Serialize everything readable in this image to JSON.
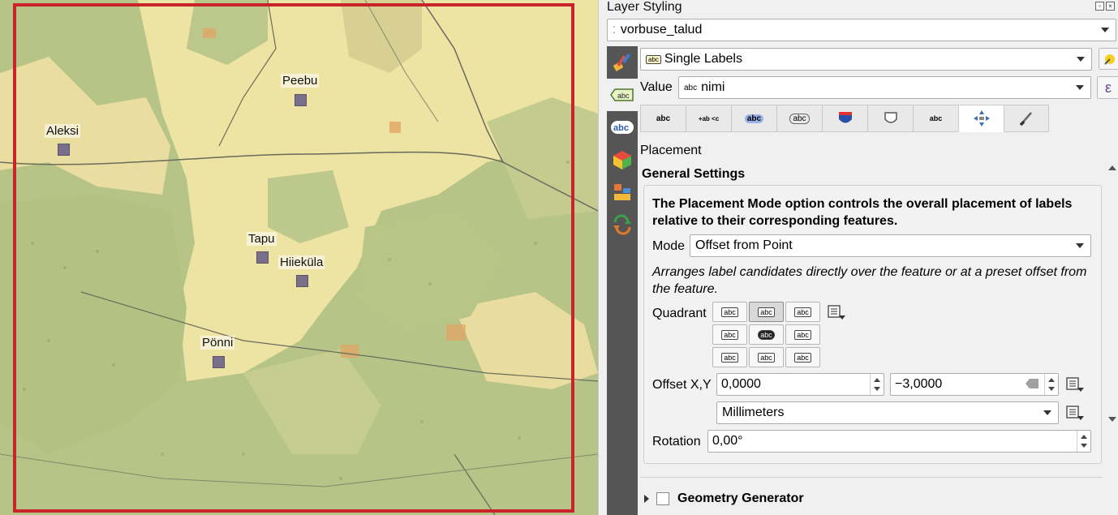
{
  "map": {
    "features": [
      {
        "name": "Peebu"
      },
      {
        "name": "Aleksi"
      },
      {
        "name": "Tapu"
      },
      {
        "name": "Hiieküla"
      },
      {
        "name": "Pönni"
      }
    ],
    "frame_color": "#c8242a",
    "marker_color": "#7a6f8a"
  },
  "panel": {
    "title": "Layer Styling",
    "layer_combo": {
      "value": "vorbuse_talud",
      "icon": "point-layer-icon"
    },
    "renderer_combo": {
      "value": "Single Labels",
      "icon": "abc-label-icon"
    },
    "value_label": "Value",
    "value_field": {
      "prefix": "abc",
      "value": "nimi"
    },
    "expression_button": "ε",
    "sidebar_icons": [
      "paint-brush-icon",
      "labels-icon",
      "abc-mask-icon",
      "3d-cube-icon",
      "diagram-icon",
      "history-icon"
    ],
    "tabs": [
      {
        "icon": "text-tab-icon",
        "label": "abc"
      },
      {
        "icon": "formatting-tab-icon",
        "label": "+ab <c"
      },
      {
        "icon": "buffer-tab-icon",
        "label": "abc"
      },
      {
        "icon": "mask-tab-icon",
        "label": "abc"
      },
      {
        "icon": "background-tab-icon",
        "label": ""
      },
      {
        "icon": "shadow-tab-icon",
        "label": ""
      },
      {
        "icon": "callouts-tab-icon",
        "label": "abc"
      },
      {
        "icon": "placement-tab-icon",
        "label": ""
      },
      {
        "icon": "rendering-tab-icon",
        "label": ""
      }
    ],
    "section_title": "Placement",
    "general_settings": "General Settings",
    "description": "The Placement Mode option controls the overall placement of labels relative to their corresponding features.",
    "mode_label": "Mode",
    "mode_value": "Offset from Point",
    "mode_help": "Arranges label candidates directly over the feature or at a preset offset from the feature.",
    "quadrant_label": "Quadrant",
    "quadrant_tag": "abc",
    "quadrant_active": 1,
    "offset_label": "Offset X,Y",
    "offset_x": "0,0000",
    "offset_y": "−3,0000",
    "units_value": "Millimeters",
    "rotation_label": "Rotation",
    "rotation_value": "0,00°",
    "geometry_generator": "Geometry Generator"
  }
}
